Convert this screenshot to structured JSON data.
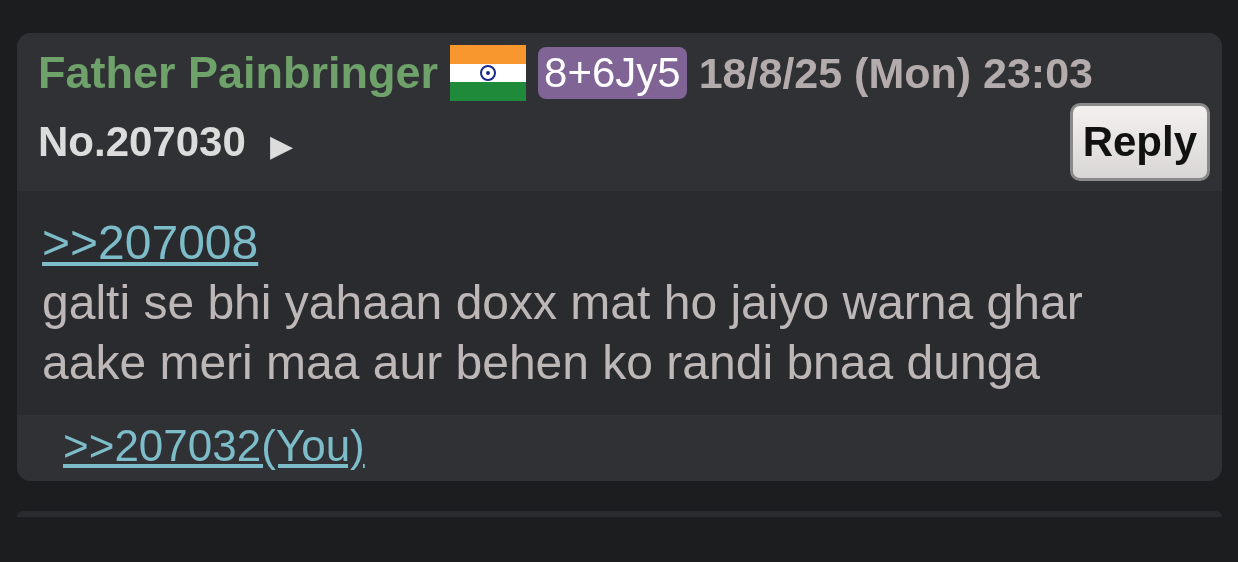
{
  "post": {
    "name": "Father Painbringer",
    "poster_id": "8+6Jy5",
    "date": "18/8/25 (Mon) 23:03",
    "number": "No.207030",
    "menu_arrow": "▶",
    "reply_button": "Reply",
    "quote_link": ">>207008",
    "body": "galti se bhi yahaan doxx mat ho jaiyo warna ghar aake meri maa aur behen ko randi bnaa dunga",
    "backlinks": [
      {
        "text": ">>207032(You)"
      }
    ]
  }
}
